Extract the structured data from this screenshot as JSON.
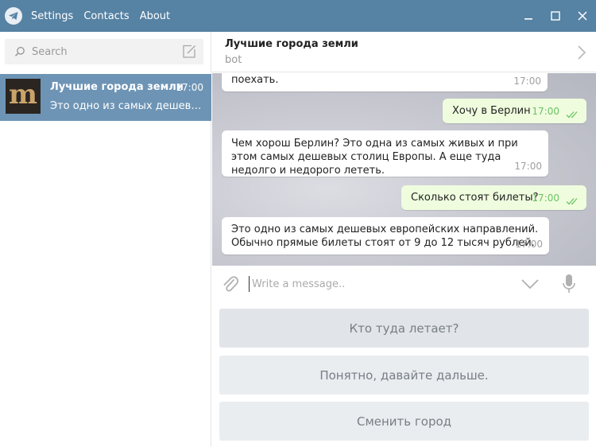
{
  "titlebar": {
    "menu": [
      "Settings",
      "Contacts",
      "About"
    ]
  },
  "sidebar": {
    "search_placeholder": "Search",
    "chats": [
      {
        "name": "Лучшие города земли",
        "time": "17:00",
        "preview": "Это одно из самых дешевых европейских направлений. Обычно прямые билеты стоят от 9 до 12 тысяч рублей.",
        "avatar_letter": "m"
      }
    ]
  },
  "chat": {
    "title": "Лучшие города земли",
    "status": "bot",
    "messages": [
      {
        "direction": "in",
        "text": "поехать.",
        "time": "17:00"
      },
      {
        "direction": "out",
        "text": "Хочу в Берлин",
        "time": "17:00"
      },
      {
        "direction": "in",
        "text": "Чем хорош Берлин? Это одна из самых живых и при этом самых дешевых столиц Европы. А еще туда недолго и недорого лететь.",
        "time": "17:00"
      },
      {
        "direction": "out",
        "text": "Сколько стоят билеты?",
        "time": "17:00"
      },
      {
        "direction": "in",
        "text": "Это одно из самых дешевых европейских направлений. Обычно прямые билеты стоят от 9 до 12 тысяч рублей.",
        "time": "17:00"
      }
    ]
  },
  "composer": {
    "placeholder": "Write a message.."
  },
  "bot_keyboard": {
    "buttons": [
      "Кто туда летает?",
      "Понятно, давайте дальше.",
      "Сменить город"
    ]
  },
  "colors": {
    "titlebar": "#5682a3",
    "selected_chat": "#6e94b5",
    "outgoing_bubble": "#effdde",
    "incoming_bubble": "#ffffff",
    "read_ticks": "#6cc264"
  }
}
